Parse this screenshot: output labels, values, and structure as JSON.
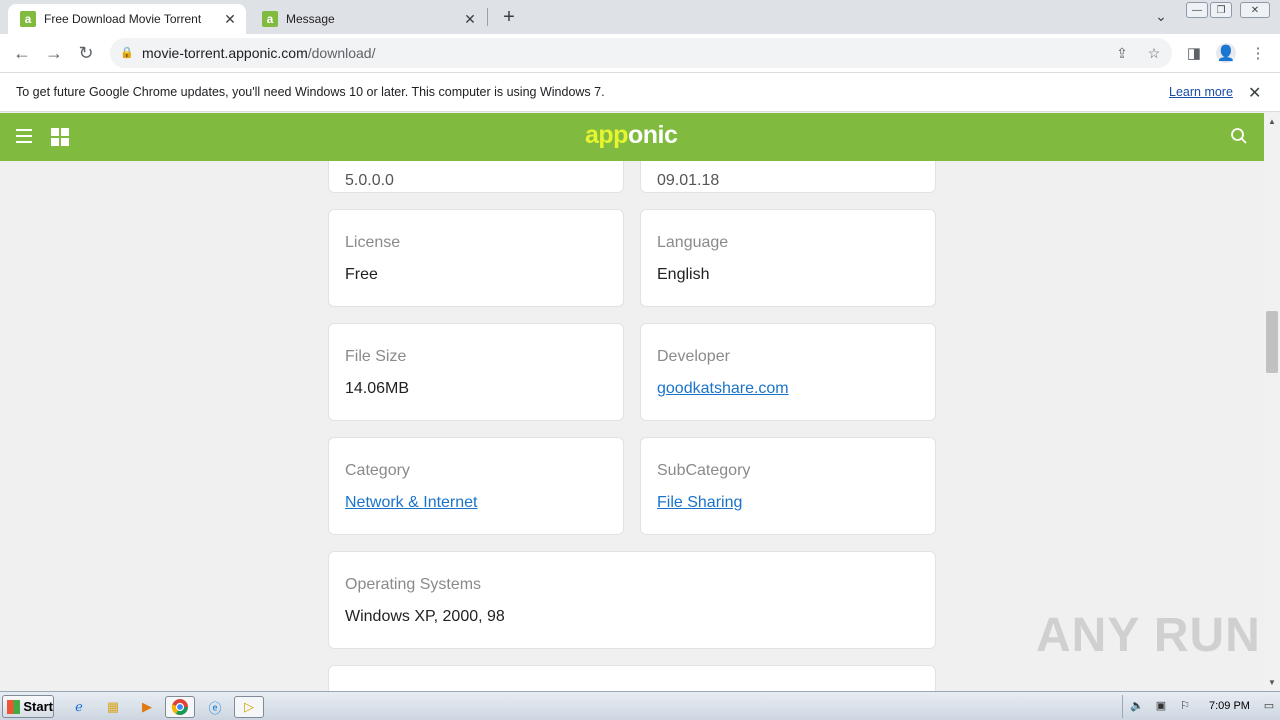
{
  "browser": {
    "tabs": [
      {
        "title": "Free Download Movie Torrent",
        "favicon": "a"
      },
      {
        "title": "Message",
        "favicon": "a"
      }
    ],
    "url_host": "movie-torrent.apponic.com",
    "url_path": "/download/"
  },
  "infobar": {
    "message": "To get future Google Chrome updates, you'll need Windows 10 or later. This computer is using Windows 7.",
    "learn_more": "Learn more"
  },
  "site": {
    "logo_part1": "app",
    "logo_part2": "onic",
    "brand_color": "#80ba3f"
  },
  "details": {
    "version_partial": "5.0.0.0",
    "date_partial": "09.01.18",
    "license": {
      "label": "License",
      "value": "Free"
    },
    "language": {
      "label": "Language",
      "value": "English"
    },
    "file_size": {
      "label": "File Size",
      "value": "14.06MB"
    },
    "developer": {
      "label": "Developer",
      "value": "goodkatshare.com"
    },
    "category": {
      "label": "Category",
      "value": "Network & Internet"
    },
    "subcategory": {
      "label": "SubCategory",
      "value": "File Sharing"
    },
    "os": {
      "label": "Operating Systems",
      "value": "Windows XP, 2000, 98"
    }
  },
  "watermark": "ANY RUN",
  "taskbar": {
    "start_label": "Start",
    "clock": "7:09 PM"
  }
}
